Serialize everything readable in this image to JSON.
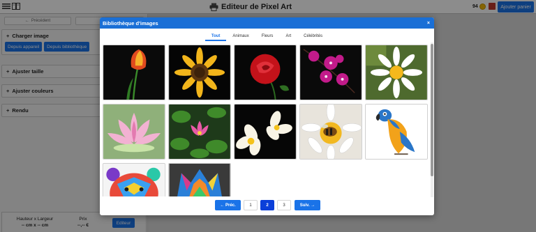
{
  "topbar": {
    "title": "Editeur de Pixel Art",
    "coins": "94",
    "cart_button": "Ajouter panier"
  },
  "sidebar": {
    "prev_label": "Précédent",
    "sections": [
      {
        "label": "Charger image",
        "buttons": [
          "Depuis appareil",
          "Depuis bibliothèque"
        ]
      },
      {
        "label": "Ajuster taille"
      },
      {
        "label": "Ajuster couleurs"
      },
      {
        "label": "Rendu"
      }
    ],
    "footer": {
      "size_label": "Hauteur x Largeur",
      "size_value": "-- cm x -- cm",
      "price_label": "Prix",
      "price_value": "--,-- €",
      "edit_button": "Editeur"
    }
  },
  "modal": {
    "title": "Bibliothèque d'images",
    "close": "×",
    "tabs": [
      "Tout",
      "Animaux",
      "Fleurs",
      "Art",
      "Célébrités"
    ],
    "active_tab": "Tout",
    "images": [
      "tulip",
      "sunflower",
      "red-rose",
      "orchid",
      "daisy",
      "lotus",
      "water-lily",
      "frangipani",
      "bee-on-flower",
      "parrot",
      "colorful-bear-art",
      "colorful-wolf-art"
    ],
    "pagination": {
      "prev": "← Préc.",
      "pages": [
        "1",
        "2",
        "3"
      ],
      "current": "2",
      "next": "Suiv. →"
    }
  },
  "colors": {
    "accent": "#1a73e8",
    "header": "#1a6fd6",
    "active_page": "#0b3fd9"
  }
}
